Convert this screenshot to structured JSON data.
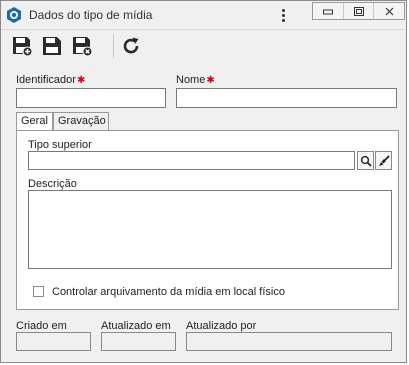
{
  "window": {
    "title": "Dados do tipo de mídia",
    "controls": [
      "minimize-icon",
      "restore-icon",
      "close-icon"
    ]
  },
  "toolbar": {
    "buttons": [
      "save-new-icon",
      "save-icon",
      "save-close-icon",
      "refresh-icon"
    ]
  },
  "form": {
    "identificador_label": "Identificador",
    "identificador_value": "",
    "nome_label": "Nome",
    "nome_value": "",
    "required_mark": "✱"
  },
  "tabs": [
    {
      "label": "Geral",
      "active": true
    },
    {
      "label": "Gravação",
      "active": false
    }
  ],
  "geral": {
    "tipo_superior_label": "Tipo superior",
    "tipo_superior_value": "",
    "descricao_label": "Descrição",
    "descricao_value": "",
    "checkbox_label": "Controlar arquivamento da mídia em local físico",
    "checkbox_checked": false
  },
  "footer": {
    "criado_em_label": "Criado em",
    "criado_em_value": "",
    "atualizado_em_label": "Atualizado em",
    "atualizado_em_value": "",
    "atualizado_por_label": "Atualizado por",
    "atualizado_por_value": ""
  },
  "colors": {
    "background": "#f0f0f0",
    "required": "#d0021b",
    "border": "#7a7a7a"
  }
}
